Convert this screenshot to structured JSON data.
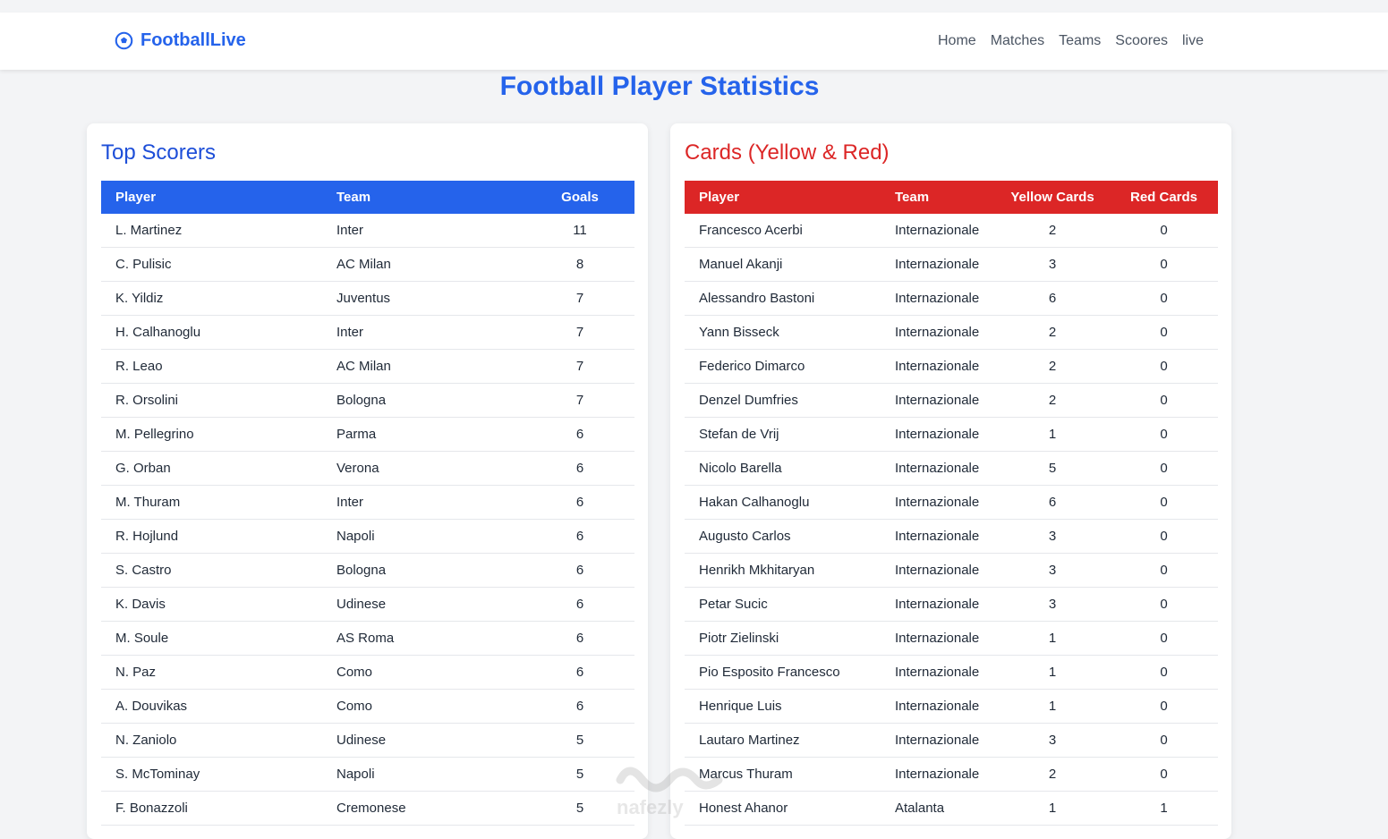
{
  "nav": {
    "brand": "FootballLive",
    "links": [
      "Home",
      "Matches",
      "Teams",
      "Scoores",
      "live"
    ]
  },
  "page_title": "Football Player Statistics",
  "scorers": {
    "title": "Top Scorers",
    "headers": [
      "Player",
      "Team",
      "Goals"
    ],
    "rows": [
      [
        "L. Martinez",
        "Inter",
        "11"
      ],
      [
        "C. Pulisic",
        "AC Milan",
        "8"
      ],
      [
        "K. Yildiz",
        "Juventus",
        "7"
      ],
      [
        "H. Calhanoglu",
        "Inter",
        "7"
      ],
      [
        "R. Leao",
        "AC Milan",
        "7"
      ],
      [
        "R. Orsolini",
        "Bologna",
        "7"
      ],
      [
        "M. Pellegrino",
        "Parma",
        "6"
      ],
      [
        "G. Orban",
        "Verona",
        "6"
      ],
      [
        "M. Thuram",
        "Inter",
        "6"
      ],
      [
        "R. Hojlund",
        "Napoli",
        "6"
      ],
      [
        "S. Castro",
        "Bologna",
        "6"
      ],
      [
        "K. Davis",
        "Udinese",
        "6"
      ],
      [
        "M. Soule",
        "AS Roma",
        "6"
      ],
      [
        "N. Paz",
        "Como",
        "6"
      ],
      [
        "A. Douvikas",
        "Como",
        "6"
      ],
      [
        "N. Zaniolo",
        "Udinese",
        "5"
      ],
      [
        "S. McTominay",
        "Napoli",
        "5"
      ],
      [
        "F. Bonazzoli",
        "Cremonese",
        "5"
      ]
    ]
  },
  "cards": {
    "title": "Cards (Yellow & Red)",
    "headers": [
      "Player",
      "Team",
      "Yellow Cards",
      "Red Cards"
    ],
    "rows": [
      [
        "Francesco Acerbi",
        "Internazionale",
        "2",
        "0"
      ],
      [
        "Manuel Akanji",
        "Internazionale",
        "3",
        "0"
      ],
      [
        "Alessandro Bastoni",
        "Internazionale",
        "6",
        "0"
      ],
      [
        "Yann Bisseck",
        "Internazionale",
        "2",
        "0"
      ],
      [
        "Federico Dimarco",
        "Internazionale",
        "2",
        "0"
      ],
      [
        "Denzel Dumfries",
        "Internazionale",
        "2",
        "0"
      ],
      [
        "Stefan de Vrij",
        "Internazionale",
        "1",
        "0"
      ],
      [
        "Nicolo Barella",
        "Internazionale",
        "5",
        "0"
      ],
      [
        "Hakan Calhanoglu",
        "Internazionale",
        "6",
        "0"
      ],
      [
        "Augusto Carlos",
        "Internazionale",
        "3",
        "0"
      ],
      [
        "Henrikh Mkhitaryan",
        "Internazionale",
        "3",
        "0"
      ],
      [
        "Petar Sucic",
        "Internazionale",
        "3",
        "0"
      ],
      [
        "Piotr Zielinski",
        "Internazionale",
        "1",
        "0"
      ],
      [
        "Pio Esposito Francesco",
        "Internazionale",
        "1",
        "0"
      ],
      [
        "Henrique Luis",
        "Internazionale",
        "1",
        "0"
      ],
      [
        "Lautaro Martinez",
        "Internazionale",
        "3",
        "0"
      ],
      [
        "Marcus Thuram",
        "Internazionale",
        "2",
        "0"
      ],
      [
        "Honest Ahanor",
        "Atalanta",
        "1",
        "1"
      ]
    ]
  },
  "watermark": "nafezly"
}
